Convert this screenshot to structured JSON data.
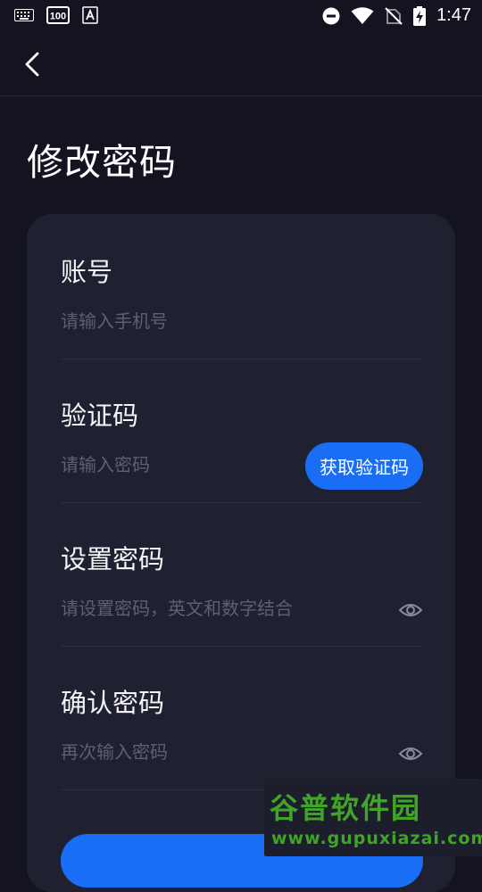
{
  "status_bar": {
    "time": "1:47",
    "battery_badge": "100",
    "icons": [
      "keyboard-icon",
      "battery-saver-icon",
      "font-a-icon",
      "do-not-disturb-icon",
      "wifi-icon",
      "no-sim-icon",
      "battery-charging-icon"
    ]
  },
  "header": {
    "back_icon": "chevron-left-icon"
  },
  "page": {
    "title": "修改密码"
  },
  "form": {
    "account": {
      "label": "账号",
      "placeholder": "请输入手机号"
    },
    "code": {
      "label": "验证码",
      "placeholder": "请输入密码",
      "button_label": "获取验证码"
    },
    "password": {
      "label": "设置密码",
      "placeholder": "请设置密码，英文和数字结合",
      "toggle_icon": "eye-icon"
    },
    "confirm": {
      "label": "确认密码",
      "placeholder": "再次输入密码",
      "toggle_icon": "eye-icon"
    }
  },
  "watermark": {
    "title": "谷普软件园",
    "url": "www.gupuxiazai.com"
  },
  "colors": {
    "background": "#13141f",
    "card": "#1f2130",
    "accent": "#1a6ef5",
    "placeholder": "#5d6072",
    "watermark": "#3fa427"
  }
}
